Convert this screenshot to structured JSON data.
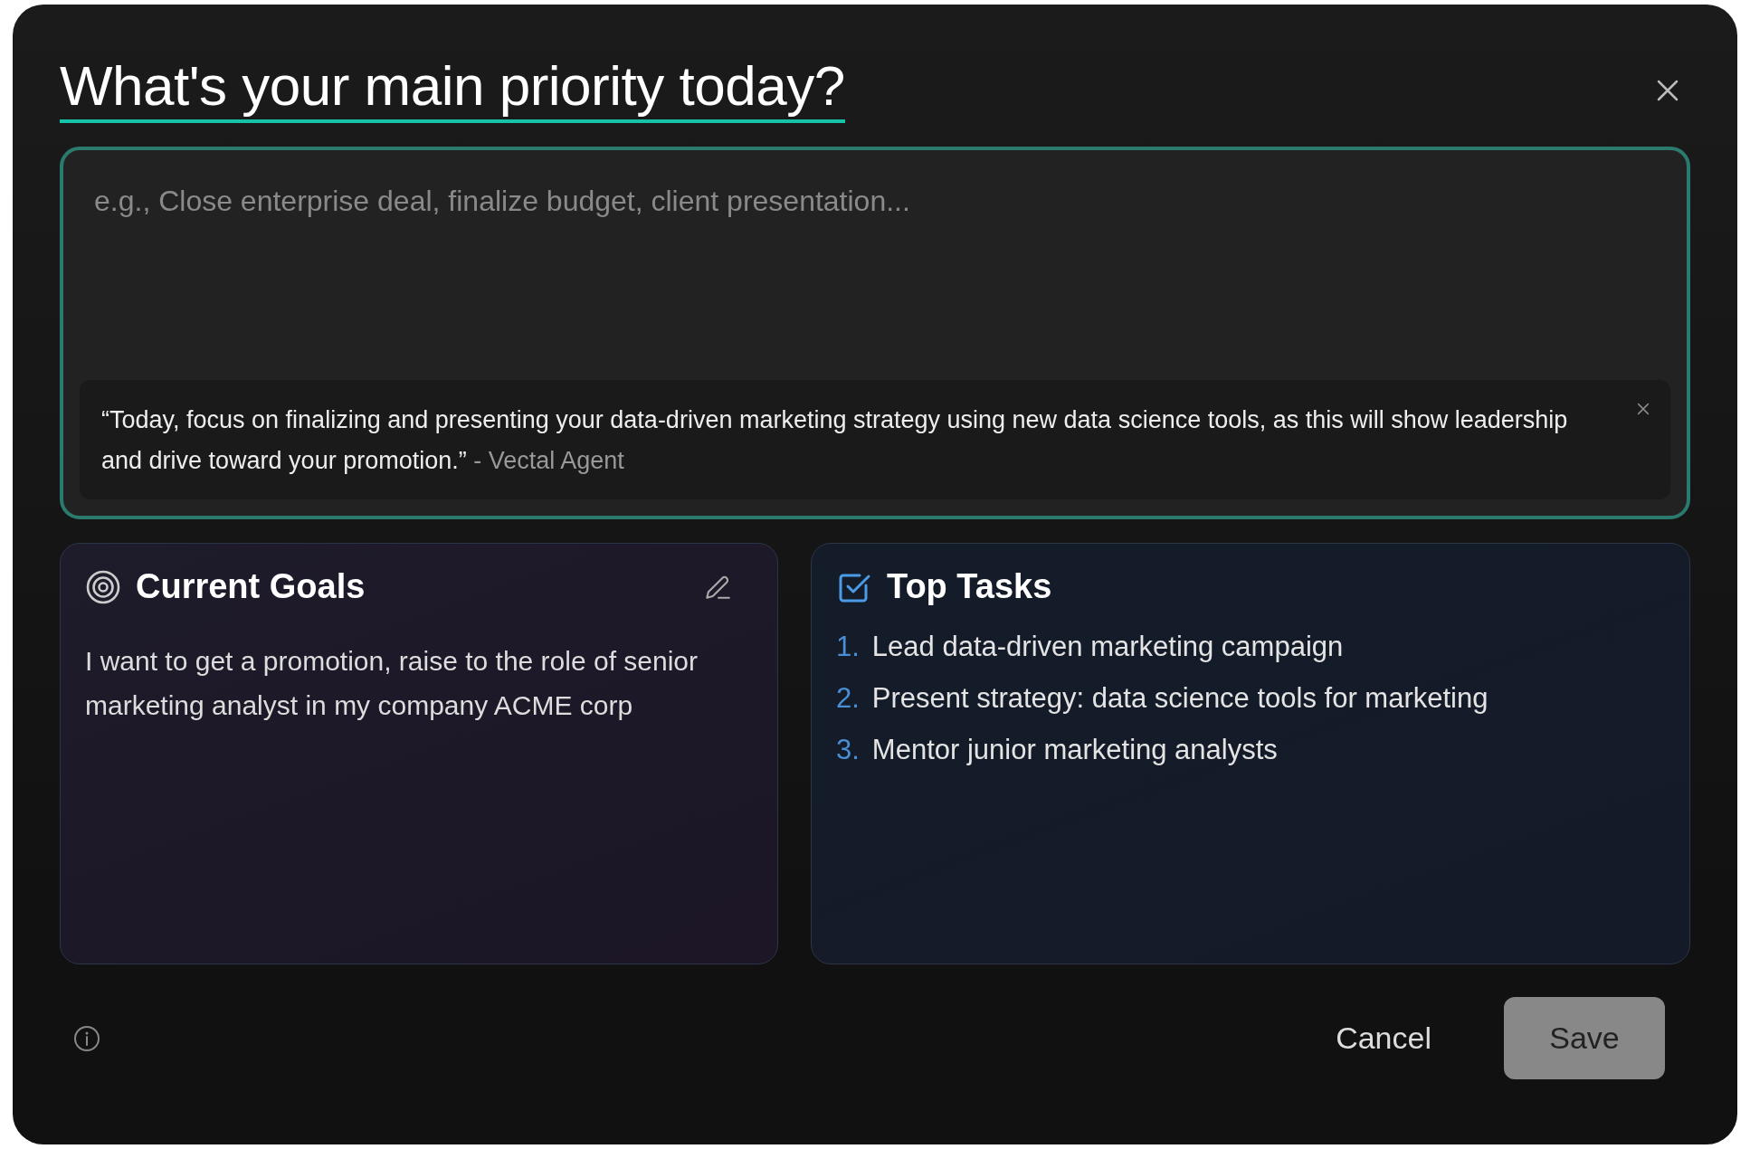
{
  "dialog": {
    "title": "What's your main priority today?"
  },
  "priority_field": {
    "placeholder": "e.g., Close enterprise deal, finalize budget, client presentation...",
    "focused": true
  },
  "suggestion": {
    "quote": "“Today, focus on finalizing and presenting your data-driven marketing strategy using new data science tools, as this will show leadership and drive toward your promotion.”",
    "attribution": "- Vectal Agent"
  },
  "goals_card": {
    "title": "Current Goals",
    "text": "I want to get a promotion, raise to the role of senior marketing analyst in my company ACME corp"
  },
  "tasks_card": {
    "title": "Top Tasks",
    "items": [
      {
        "number": "1.",
        "text": "Lead data-driven marketing campaign"
      },
      {
        "number": "2.",
        "text": "Present strategy: data science tools for marketing"
      },
      {
        "number": "3.",
        "text": "Mentor junior marketing analysts"
      }
    ]
  },
  "buttons": [
    {
      "label": "Cancel",
      "kind": "text",
      "disabled": false
    },
    {
      "label": "Save",
      "kind": "primary",
      "disabled": true
    }
  ]
}
